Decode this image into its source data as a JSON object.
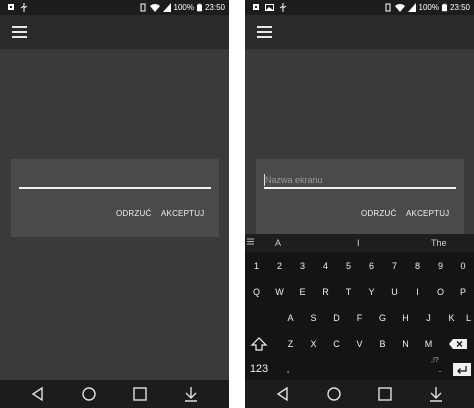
{
  "status_bar": {
    "battery_percent": "100%",
    "time": "23:50",
    "icons_left": [
      "notification-icon",
      "image-icon",
      "usb-icon"
    ],
    "icons_right": [
      "vibrate-icon",
      "wifi-icon",
      "signal-icon",
      "battery-icon"
    ]
  },
  "dialog": {
    "input_value": "",
    "placeholder": "Nazwa ekranu",
    "dismiss_label": "ODRZUĆ",
    "accept_label": "AKCEPTUJ"
  },
  "keyboard": {
    "suggestions": [
      "A",
      "I",
      "The"
    ],
    "number_row": [
      "1",
      "2",
      "3",
      "4",
      "5",
      "6",
      "7",
      "8",
      "9",
      "0"
    ],
    "row1": [
      "Q",
      "W",
      "E",
      "R",
      "T",
      "Y",
      "U",
      "I",
      "O",
      "P"
    ],
    "row2": [
      "A",
      "S",
      "D",
      "F",
      "G",
      "H",
      "J",
      "K",
      "L"
    ],
    "row3": [
      "Z",
      "X",
      "C",
      "V",
      "B",
      "N",
      "M"
    ],
    "symbols_label": "123",
    "comma_label": ",",
    "period_label": ".",
    "punctuation_hint": ",!?"
  },
  "nav": {
    "icons": [
      "back-icon",
      "home-icon",
      "recents-icon",
      "hide-keyboard-icon"
    ]
  },
  "colors": {
    "background": "#3a3a3a",
    "app_bar": "#2a2a2a",
    "dialog": "#4a4a4a",
    "status_bar": "#1c1c1c",
    "keyboard": "#141414"
  }
}
